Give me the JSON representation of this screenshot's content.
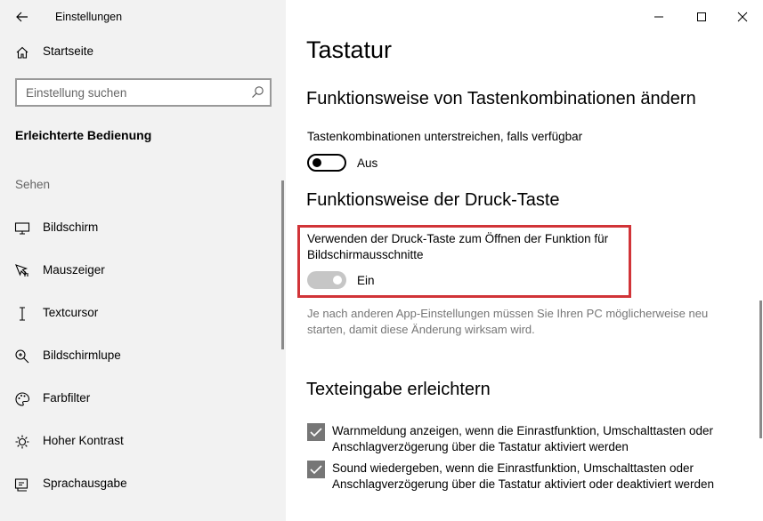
{
  "window": {
    "title": "Einstellungen",
    "controls": [
      "minimize",
      "maximize",
      "close"
    ]
  },
  "sidebar": {
    "home_label": "Startseite",
    "search": {
      "placeholder": "Einstellung suchen",
      "value": ""
    },
    "section_title": "Erleichterte Bedienung",
    "group_label": "Sehen",
    "items": [
      {
        "label": "Bildschirm",
        "icon": "monitor-icon"
      },
      {
        "label": "Mauszeiger",
        "icon": "pointer-icon"
      },
      {
        "label": "Textcursor",
        "icon": "text-cursor-icon"
      },
      {
        "label": "Bildschirmlupe",
        "icon": "magnifier-icon"
      },
      {
        "label": "Farbfilter",
        "icon": "palette-icon"
      },
      {
        "label": "Hoher Kontrast",
        "icon": "contrast-icon"
      },
      {
        "label": "Sprachausgabe",
        "icon": "narrator-icon"
      }
    ]
  },
  "main": {
    "title": "Tastatur",
    "section1": {
      "heading": "Funktionsweise von Tastenkombinationen ändern",
      "setting_label": "Tastenkombinationen unterstreichen, falls verfügbar",
      "toggle_on": false,
      "toggle_state": "Aus"
    },
    "section2": {
      "heading": "Funktionsweise der Druck-Taste",
      "setting_label": "Verwenden der Druck-Taste zum Öffnen der Funktion für Bildschirmausschnitte",
      "toggle_on": true,
      "toggle_state": "Ein",
      "hint": "Je nach anderen App-Einstellungen müssen Sie Ihren PC möglicherweise neu starten, damit diese Änderung wirksam wird.",
      "highlight_color": "#d13438"
    },
    "section3": {
      "heading": "Texteingabe erleichtern",
      "checkboxes": [
        {
          "checked": true,
          "label": "Warnmeldung anzeigen, wenn die Einrastfunktion, Umschalttasten oder Anschlagverzögerung über die Tastatur aktiviert werden"
        },
        {
          "checked": true,
          "label": "Sound wiedergeben, wenn die Einrastfunktion, Umschalttasten oder Anschlagverzögerung über die Tastatur aktiviert oder deaktiviert werden"
        }
      ]
    }
  }
}
